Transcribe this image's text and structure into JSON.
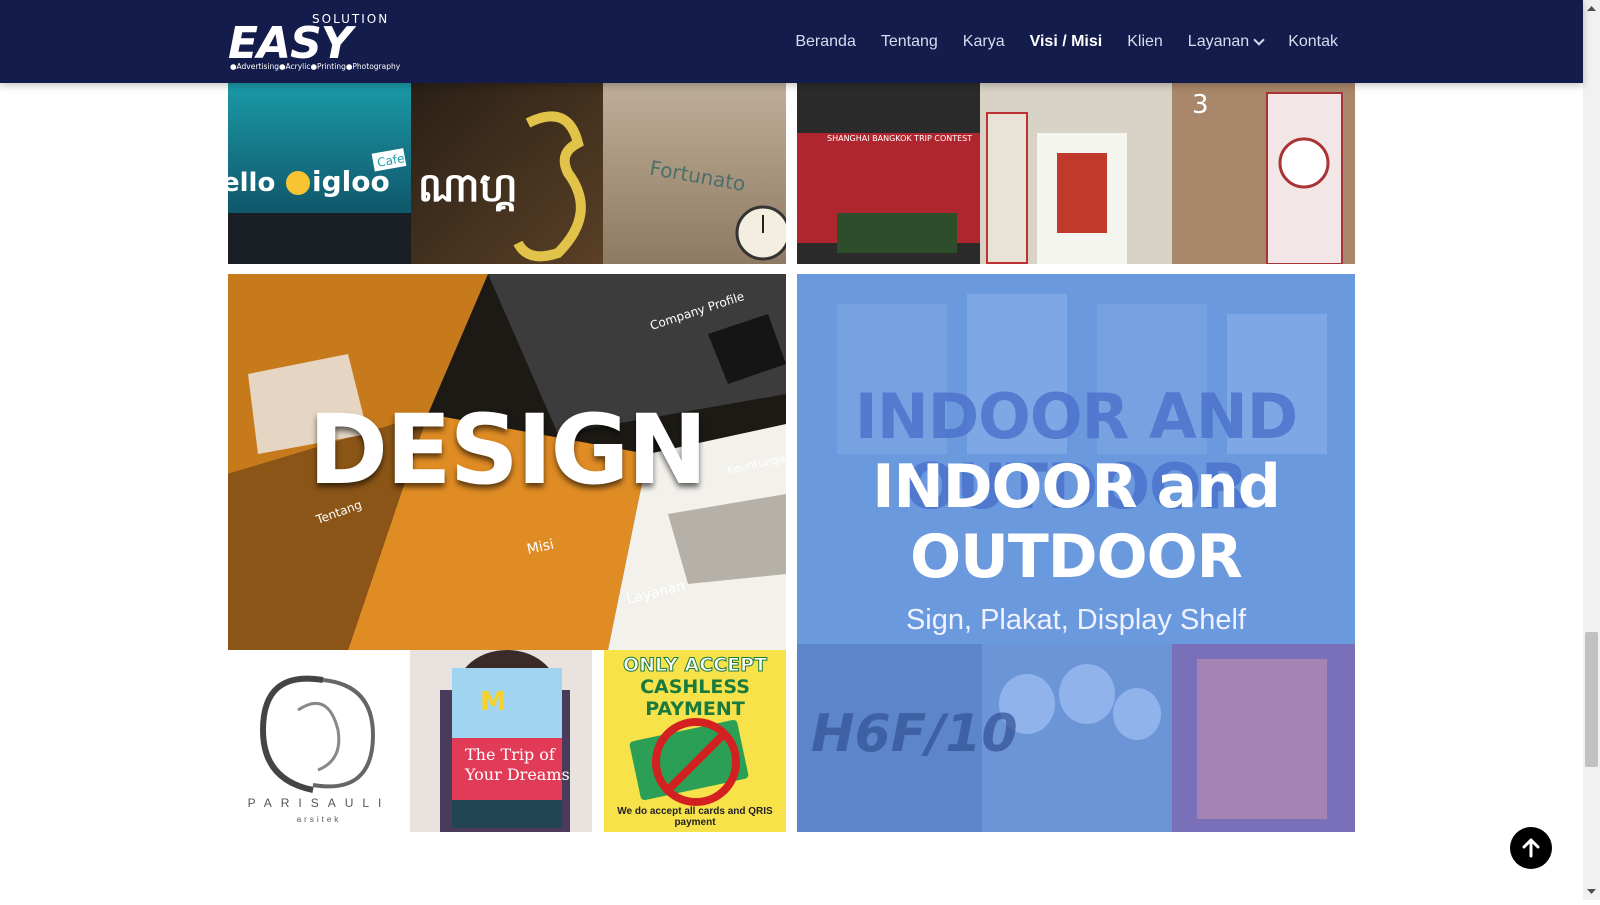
{
  "brand": {
    "logo_small": "SOLUTION",
    "logo_main": "EASY",
    "logo_tagline": "●Advertising●Acrylic●Printing●Photography"
  },
  "nav": {
    "items": [
      {
        "label": "Beranda"
      },
      {
        "label": "Tentang"
      },
      {
        "label": "Karya"
      },
      {
        "label": "Visi / Misi",
        "active": true
      },
      {
        "label": "Klien"
      },
      {
        "label": "Layanan",
        "dropdown": true
      },
      {
        "label": "Kontak"
      }
    ]
  },
  "tiles": {
    "signage_top_left": {
      "captions": [
        "hello igloo",
        "Cafe",
        "Fortunato"
      ]
    },
    "signage_top_right": {
      "captions": [
        "3"
      ]
    },
    "design": {
      "title": "DESIGN",
      "company_profile": "Company Profile",
      "thumbnails": {
        "parisauli": "PARISAULI",
        "parisauli_sub": "arsitek",
        "cashless_line1": "ONLY ACCEPT",
        "cashless_line2": "CASHLESS PAYMENT",
        "cashless_footer": "We do accept all cards and QRIS payment"
      }
    },
    "indoor_outdoor": {
      "background_text": "INDOOR AND OUTDOOR",
      "title_line1": "INDOOR and",
      "title_line2": "OUTDOOR",
      "subtitle": "Sign, Plakat, Display Shelf",
      "bottom_caption": "H6F/10"
    }
  },
  "colors": {
    "header_bg": "#131c4a",
    "overlay_blue": "#6393dc",
    "back_to_top": "#000000"
  },
  "icons": {
    "back_to_top": "arrow-up-icon",
    "nav_dropdown": "chevron-down-icon"
  }
}
